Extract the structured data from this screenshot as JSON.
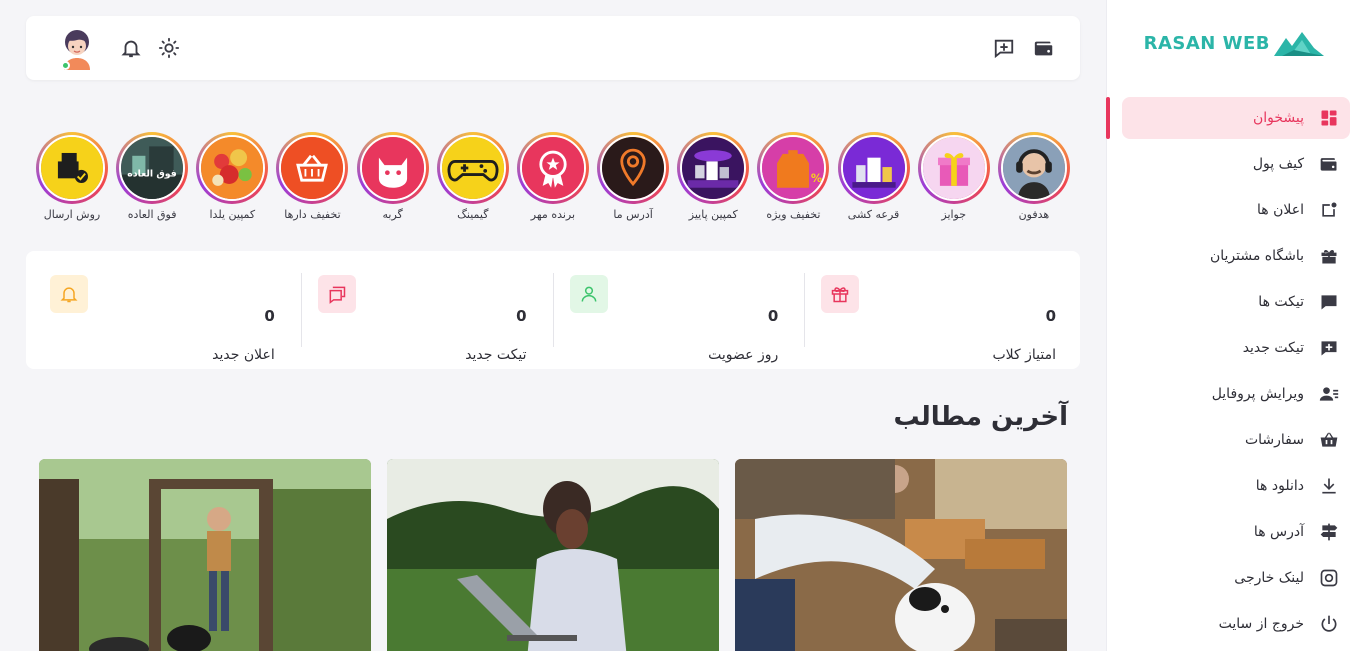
{
  "brand": {
    "name": "RASAN WEB",
    "color": "#2bb5a8"
  },
  "accent": "#e8365d",
  "sidebar": {
    "items": [
      {
        "label": "پیشخوان",
        "icon": "dashboard-icon",
        "active": true
      },
      {
        "label": "کیف پول",
        "icon": "wallet-icon"
      },
      {
        "label": "اعلان ها",
        "icon": "notification-square-icon"
      },
      {
        "label": "باشگاه مشتریان",
        "icon": "gift-icon"
      },
      {
        "label": "تیکت ها",
        "icon": "chat-icon"
      },
      {
        "label": "تیکت جدید",
        "icon": "chat-plus-icon"
      },
      {
        "label": "ویرایش پروفایل",
        "icon": "user-edit-icon"
      },
      {
        "label": "سفارشات",
        "icon": "basket-icon"
      },
      {
        "label": "دانلود ها",
        "icon": "download-icon"
      },
      {
        "label": "آدرس ها",
        "icon": "signpost-icon"
      },
      {
        "label": "لینک خارجی",
        "icon": "instagram-icon"
      },
      {
        "label": "خروج از سایت",
        "icon": "power-icon"
      }
    ]
  },
  "header": {
    "icons": [
      "wallet-icon",
      "chat-plus-icon",
      "sun-icon",
      "bell-icon",
      "avatar"
    ]
  },
  "stories": [
    {
      "label": "هدفون"
    },
    {
      "label": "جوایز"
    },
    {
      "label": "قرعه کشی"
    },
    {
      "label": "تخفیف ویژه"
    },
    {
      "label": "کمپین پاییز"
    },
    {
      "label": "آدرس ما"
    },
    {
      "label": "برنده مهر"
    },
    {
      "label": "گیمینگ"
    },
    {
      "label": "گربه"
    },
    {
      "label": "تخفیف دارها"
    },
    {
      "label": "کمپین یلدا"
    },
    {
      "label": "فوق العاده",
      "overlay": "فوق العاده"
    },
    {
      "label": "روش ارسال"
    }
  ],
  "stats": [
    {
      "label": "امتیاز کلاب",
      "value": "0",
      "icon": "gift-icon",
      "bg": "#fde3e8",
      "fg": "#e8365d"
    },
    {
      "label": "روز عضویت",
      "value": "0",
      "icon": "user-icon",
      "bg": "#e2f7e6",
      "fg": "#3cc46c"
    },
    {
      "label": "تیکت جدید",
      "value": "0",
      "icon": "chat-icon",
      "bg": "#fde3e8",
      "fg": "#e8365d"
    },
    {
      "label": "اعلان جدید",
      "value": "0",
      "icon": "bell-icon",
      "bg": "#fff1d6",
      "fg": "#f5a623"
    }
  ],
  "latest": {
    "title": "آخرین مطالب"
  }
}
